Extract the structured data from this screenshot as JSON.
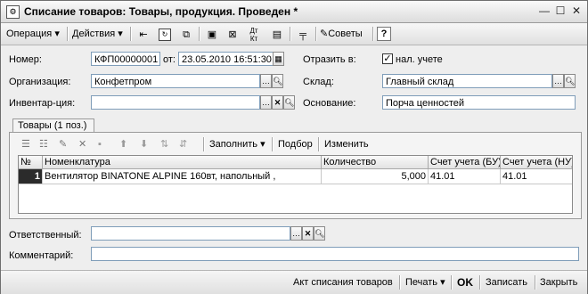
{
  "window": {
    "title": "Списание товаров: Товары, продукция. Проведен *",
    "minimize_icon": "minimize-icon",
    "maximize_icon": "maximize-icon",
    "close_icon": "close-icon"
  },
  "toolbar": {
    "operation_label": "Операция",
    "actions_label": "Действия",
    "dtkt_label": "Дт Кт",
    "tips_label": "Советы",
    "help_label": "?"
  },
  "form": {
    "number_label": "Номер:",
    "number_value": "КФП00000001",
    "date_label": "от:",
    "date_value": "23.05.2010 16:51:30",
    "reflect_label": "Отразить в:",
    "tax_checkbox_label": "нал. учете",
    "tax_checked": "✓",
    "org_label": "Организация:",
    "org_value": "Конфетпром",
    "warehouse_label": "Склад:",
    "warehouse_value": "Главный склад",
    "inventory_label": "Инвентар-ция:",
    "inventory_value": "",
    "basis_label": "Основание:",
    "basis_value": "Порча ценностей",
    "responsible_label": "Ответственный:",
    "responsible_value": "",
    "comment_label": "Комментарий:",
    "comment_value": ""
  },
  "tab": {
    "label": "Товары (1 поз.)",
    "fill_label": "Заполнить",
    "select_label": "Подбор",
    "change_label": "Изменить"
  },
  "table": {
    "headers": [
      "№",
      "Номенклатура",
      "Количество",
      "Счет учета (БУ)",
      "Счет учета (НУ)"
    ],
    "rows": [
      [
        "1",
        "Вентилятор BINATONE ALPINE 160вт, напольный ,",
        "5,000",
        "41.01",
        "41.01"
      ]
    ]
  },
  "statusbar": {
    "act_label": "Акт списания товаров",
    "print_label": "Печать",
    "ok_label": "OK",
    "save_label": "Записать",
    "close_label": "Закрыть"
  }
}
